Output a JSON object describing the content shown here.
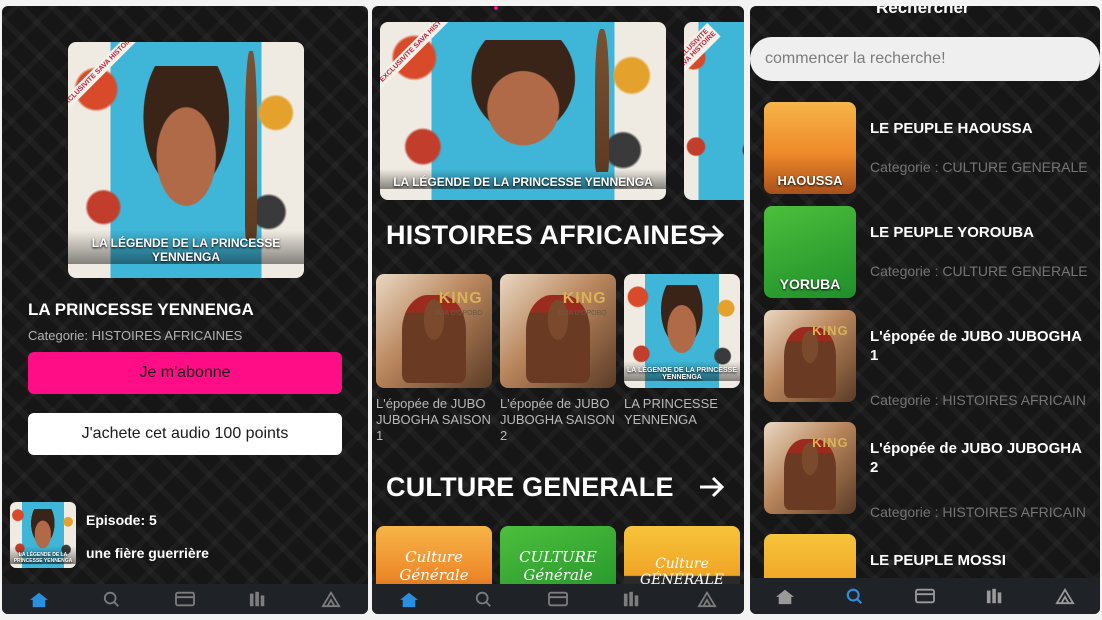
{
  "screen1": {
    "hero": {
      "ribbon": "EXCLUSIVITE SAVA HISTOIRE",
      "cover_title": "LA LÉGENDE DE LA PRINCESSE YENNENGA"
    },
    "title": "LA PRINCESSE YENNENGA",
    "category": "Categorie: HISTOIRES AFRICAINES",
    "subscribe_label": "Je m'abonne",
    "buy_label": "J'achete cet audio 100 points",
    "episode": {
      "number_label": "Episode: 5",
      "name": "une fière guerrière",
      "cover_title": "LA LÉGENDE DE LA PRINCESSE YENNENGA"
    }
  },
  "screen2": {
    "featured_cover_title": "LA LÉGENDE DE LA PRINCESSE YENNENGA",
    "featured_ribbon": "EXCLUSIVITE SAVA HISTOIRE",
    "section1": {
      "title": "HISTOIRES AFRICAINES",
      "cards": [
        {
          "label": "L'épopée de JUBO JUBOGHA SAISON 1",
          "cover_word": "KING",
          "cover_sub": "JAJA D'OPOBO"
        },
        {
          "label": "L'épopée de JUBO JUBOGHA SAISON 2",
          "cover_word": "KING",
          "cover_sub": "JAJA D'OPOBO"
        },
        {
          "label": "LA PRINCESSE YENNENGA",
          "cover_title": "LA LÉGENDE DE LA PRINCESSE YENNENGA"
        }
      ]
    },
    "section2": {
      "title": "CULTURE GENERALE",
      "cards": [
        {
          "cover_word": "Culture Générale"
        },
        {
          "cover_word": "CULTURE Générale"
        },
        {
          "cover_word": "Culture GÉNÉRALE"
        }
      ]
    }
  },
  "screen3": {
    "title": "Rechercher",
    "search_placeholder": "commencer la recherche!",
    "results": [
      {
        "title": "LE PEUPLE HAOUSSA",
        "category": "Categorie : CULTURE GENERALE",
        "cover_word": "HAOUSSA"
      },
      {
        "title": "LE PEUPLE YOROUBA",
        "category": "Categorie : CULTURE GENERALE",
        "cover_word": "YORUBA"
      },
      {
        "title": "L'épopée de JUBO JUBOGHA 1",
        "category": "Categorie : HISTOIRES AFRICAIN",
        "cover_word": "KING"
      },
      {
        "title": "L'épopée de JUBO JUBOGHA 2",
        "category": "Categorie : HISTOIRES AFRICAIN",
        "cover_word": "KING"
      },
      {
        "title": "LE PEUPLE MOSSI",
        "category": "",
        "cover_word": ""
      }
    ]
  },
  "nav": {
    "items": [
      "home-icon",
      "search-icon",
      "subscription-card-icon",
      "library-icon",
      "profile-logo-icon"
    ]
  },
  "colors": {
    "accent_pink": "#ff0d86",
    "active_home": "#2b8fe0",
    "active_search": "#2b8fe0",
    "background": "#161616"
  }
}
